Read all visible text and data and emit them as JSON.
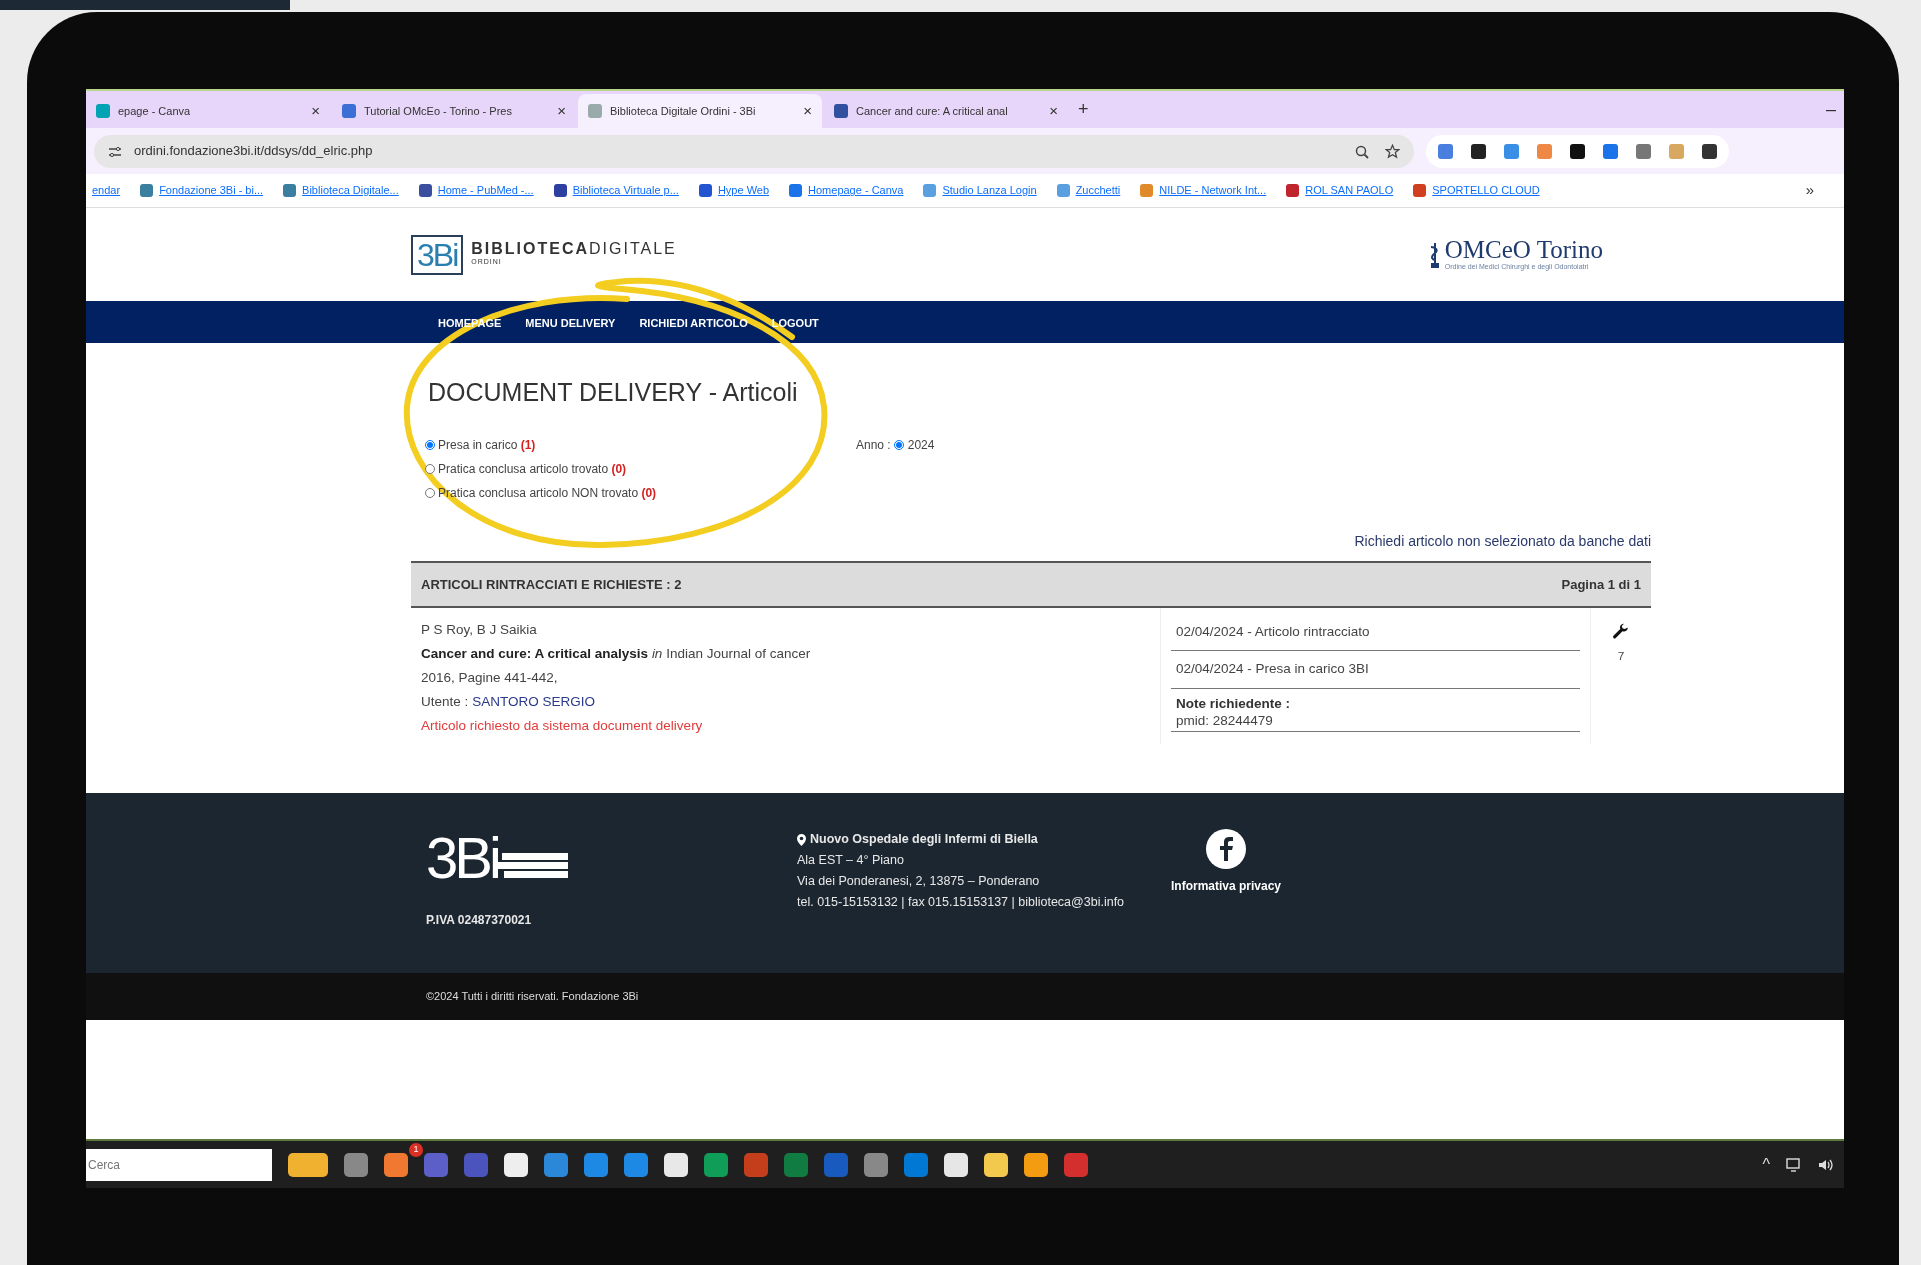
{
  "browser": {
    "tabs": [
      {
        "title": "epage - Canva",
        "close": "×",
        "selected": false
      },
      {
        "title": "Tutorial OMcEo - Torino - Pres",
        "close": "×",
        "selected": false
      },
      {
        "title": "Biblioteca Digitale Ordini - 3Bi",
        "close": "×",
        "selected": true
      },
      {
        "title": "Cancer and cure: A critical anal",
        "close": "×",
        "selected": false
      }
    ],
    "new_tab": "+",
    "minimize": "–",
    "address": "ordini.fondazione3bi.it/ddsys/dd_elric.php",
    "bookmarks": [
      {
        "label": "endar"
      },
      {
        "label": "Fondazione 3Bi - bi..."
      },
      {
        "label": "Biblioteca Digitale..."
      },
      {
        "label": "Home - PubMed -..."
      },
      {
        "label": "Biblioteca Virtuale p..."
      },
      {
        "label": "Hype Web"
      },
      {
        "label": "Homepage - Canva"
      },
      {
        "label": "Studio Lanza Login"
      },
      {
        "label": "Zucchetti"
      },
      {
        "label": "NILDE - Network Int..."
      },
      {
        "label": "ROL SAN PAOLO"
      },
      {
        "label": "SPORTELLO CLOUD"
      }
    ],
    "more": "»"
  },
  "site": {
    "logo": {
      "mark": "3Bi",
      "name": "**BIBLIOTECA**DIGITALE",
      "sub": "ORDINI"
    },
    "partner": {
      "name": "OMCeO Torino",
      "subtitle": "Ordine dei Medici Chirurghi e degli Odontoiatri"
    },
    "nav": [
      "HOMEPAGE",
      "MENU DELIVERY",
      "RICHIEDI ARTICOLO",
      "LOGOUT"
    ],
    "title": "DOCUMENT DELIVERY - Articoli",
    "filters": [
      {
        "label": "Presa in carico",
        "count": "(1)",
        "selected": true
      },
      {
        "label": "Pratica conclusa articolo trovato",
        "count": "(0)",
        "selected": false
      },
      {
        "label": "Pratica conclusa articolo NON trovato",
        "count": "(0)",
        "selected": false
      }
    ],
    "year": {
      "label": "Anno :",
      "options": [
        {
          "label": "2024",
          "selected": true
        }
      ]
    },
    "request_link": "Richiedi articolo non selezionato da banche dati",
    "table": {
      "heading": "ARTICOLI RINTRACCIATI E RICHIESTE : 2",
      "page": "Pagina 1 di 1",
      "rows": [
        {
          "authors": "P S Roy, B J Saikia",
          "citation": "**Cancer and cure: A critical analysis** *in* Indian Journal of cancer",
          "details": "2016, Pagine 441-442,",
          "user_label": "Utente :",
          "user": "SANTORO SERGIO",
          "origin": "Articolo richiesto da sistema document delivery",
          "events": [
            "02/04/2024 - Articolo rintracciato",
            "02/04/2024 - Presa in carico 3BI"
          ],
          "note_label": "Note richiedente :",
          "note": "pmid: 28244479",
          "count": "7"
        }
      ]
    }
  },
  "footer": {
    "logo": "3Bi",
    "vat": "P.IVA 02487370021",
    "address": [
      "Nuovo Ospedale degli Infermi di Biella",
      "Ala EST – 4° Piano",
      "Via dei Ponderanesi, 2, 13875 – Ponderano",
      "tel. 015-15153132 | fax 015.15153137 | biblioteca@3bi.info"
    ],
    "privacy": "Informativa privacy",
    "copyright": "©2024 Tutti i diritti riservati. Fondazione 3Bi"
  },
  "taskbar": {
    "search_placeholder": "Cerca",
    "badge": "1",
    "tray_caret": "^"
  }
}
